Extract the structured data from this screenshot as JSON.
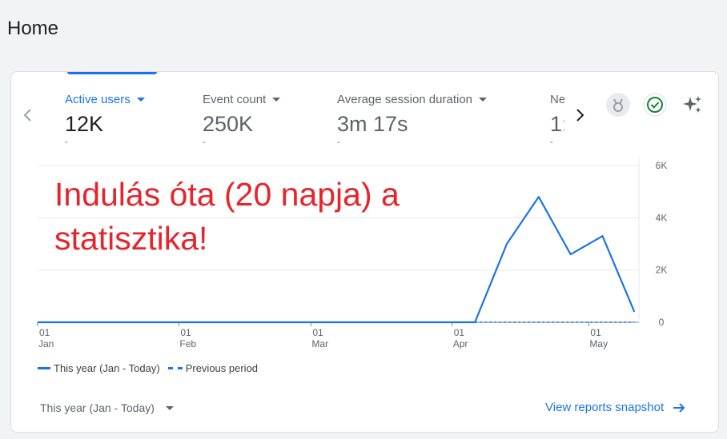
{
  "page": {
    "title": "Home"
  },
  "metrics": [
    {
      "label": "Active users",
      "value": "12K",
      "delta": "-"
    },
    {
      "label": "Event count",
      "value": "250K",
      "delta": "-"
    },
    {
      "label": "Average session duration",
      "value": "3m 17s",
      "delta": "-"
    },
    {
      "label": "Ne",
      "value": "1:",
      "delta": "-"
    }
  ],
  "annotation": {
    "line1": "Indulás óta (20 napja) a",
    "line2": "statisztika!"
  },
  "chart_data": {
    "type": "line",
    "x_ticks": [
      {
        "day": "01",
        "month": "Jan"
      },
      {
        "day": "01",
        "month": "Feb"
      },
      {
        "day": "01",
        "month": "Mar"
      },
      {
        "day": "01",
        "month": "Apr"
      },
      {
        "day": "01",
        "month": "May"
      }
    ],
    "y_ticks": [
      "6K",
      "4K",
      "2K",
      "0"
    ],
    "ylim": [
      0,
      6000
    ],
    "x_range": [
      "2024-01-01",
      "2024-05-12"
    ],
    "series": [
      {
        "name": "This year (Jan - Today)",
        "style": "solid",
        "color": "#1a73e8",
        "points": [
          {
            "x": "2024-01-01",
            "y": 0
          },
          {
            "x": "2024-04-06",
            "y": 0
          },
          {
            "x": "2024-04-13",
            "y": 3000
          },
          {
            "x": "2024-04-20",
            "y": 4800
          },
          {
            "x": "2024-04-27",
            "y": 2600
          },
          {
            "x": "2024-05-04",
            "y": 3300
          },
          {
            "x": "2024-05-11",
            "y": 400
          }
        ]
      },
      {
        "name": "Previous period",
        "style": "dashed",
        "color": "#1a73e8",
        "points": [
          {
            "x": "2024-04-06",
            "y": 0
          },
          {
            "x": "2024-05-11",
            "y": 0
          }
        ]
      }
    ],
    "grid": true,
    "legend_position": "bottom-left"
  },
  "footer": {
    "date_range": "This year (Jan - Today)",
    "view_link": "View reports snapshot"
  },
  "icons": {
    "prev": "chevron-left-icon",
    "next": "chevron-right-icon",
    "insights": "medal-icon",
    "status": "check-circle-icon",
    "ai": "sparkle-icon",
    "link": "arrow-right-icon"
  },
  "colors": {
    "accent": "#1a73e8",
    "annotation": "#e8242b",
    "status": "#188038"
  }
}
